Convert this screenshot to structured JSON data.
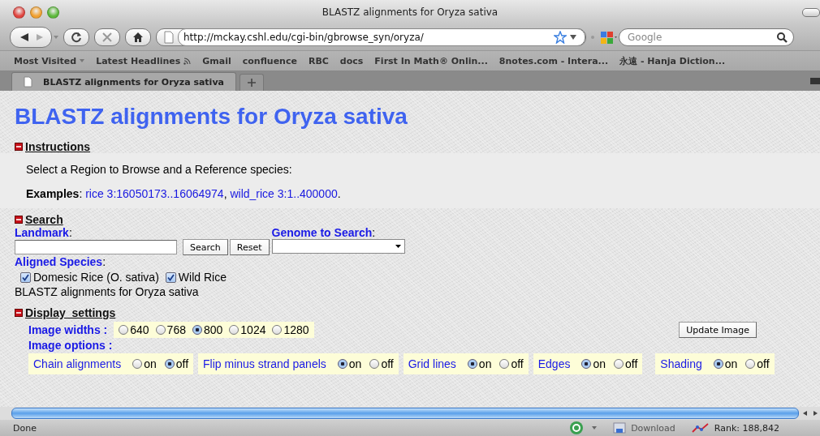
{
  "window": {
    "title": "BLASTZ alignments for Oryza sativa"
  },
  "toolbar": {
    "url": "http://mckay.cshl.edu/cgi-bin/gbrowse_syn/oryza/",
    "search": {
      "placeholder": "Google"
    }
  },
  "bookmarks": [
    {
      "label": "Most Visited",
      "kind": "menu"
    },
    {
      "label": "Latest Headlines",
      "kind": "feed"
    },
    {
      "label": "Gmail",
      "kind": "plain"
    },
    {
      "label": "confluence",
      "kind": "plain"
    },
    {
      "label": "RBC",
      "kind": "plain"
    },
    {
      "label": "docs",
      "kind": "plain"
    },
    {
      "label": "First In Math® Onlin...",
      "kind": "plain"
    },
    {
      "label": "8notes.com - Intera...",
      "kind": "plain"
    },
    {
      "label": "永遠 - Hanja Diction...",
      "kind": "plain"
    }
  ],
  "tabs": [
    {
      "label": "BLASTZ alignments for Oryza sativa",
      "selected": true
    }
  ],
  "page": {
    "heading": "BLASTZ alignments for Oryza sativa",
    "instructions": {
      "title": "Instructions",
      "expanded": true,
      "text": "Select a Region to Browse and a Reference species:",
      "examples": {
        "lead": "**Examples**: ",
        "links": [
          {
            "text": "rice 3:16050173..16064974",
            "after": ", "
          },
          {
            "text": "wild_rice 3:1..400000",
            "after": "."
          }
        ]
      }
    },
    "search": {
      "title": "Search",
      "expanded": true,
      "landmark": {
        "label": "Landmark",
        "punct": ":"
      },
      "buttons": [
        "Search",
        "Reset"
      ],
      "genome": {
        "label": "Genome to Search",
        "punct": ":"
      },
      "species": {
        "label": "Aligned Species",
        "punct": ":"
      },
      "species_options": [
        {
          "label": "Domesic Rice (O. sativa)",
          "checked": true
        },
        {
          "label": "Wild Rice",
          "checked": true
        }
      ],
      "note": "BLASTZ alignments for Oryza sativa"
    },
    "display": {
      "title": "Display_settings",
      "expanded": true,
      "widths_label": "Image widths :",
      "widths": [
        {
          "label": "640",
          "selected": false
        },
        {
          "label": "768",
          "selected": false
        },
        {
          "label": "800",
          "selected": true
        },
        {
          "label": "1024",
          "selected": false
        },
        {
          "label": "1280",
          "selected": false
        }
      ],
      "update_button": "Update Image",
      "options_label": "Image options :",
      "options": [
        {
          "name": "Chain alignments",
          "choices": [
            {
              "label": "on",
              "selected": false
            },
            {
              "label": "off",
              "selected": true
            }
          ]
        },
        {
          "name": "Flip minus strand panels",
          "choices": [
            {
              "label": "on",
              "selected": true
            },
            {
              "label": "off",
              "selected": false
            }
          ]
        },
        {
          "name": "Grid lines",
          "choices": [
            {
              "label": "on",
              "selected": true
            },
            {
              "label": "off",
              "selected": false
            }
          ]
        },
        {
          "name": "Edges",
          "choices": [
            {
              "label": "on",
              "selected": true
            },
            {
              "label": "off",
              "selected": false
            }
          ]
        },
        {
          "name": "Shading",
          "choices": [
            {
              "label": "on",
              "selected": true
            },
            {
              "label": "off",
              "selected": false
            }
          ]
        }
      ]
    }
  },
  "status_bar": {
    "text": "Done",
    "download": "Download",
    "rank": "Rank: 188,842"
  }
}
